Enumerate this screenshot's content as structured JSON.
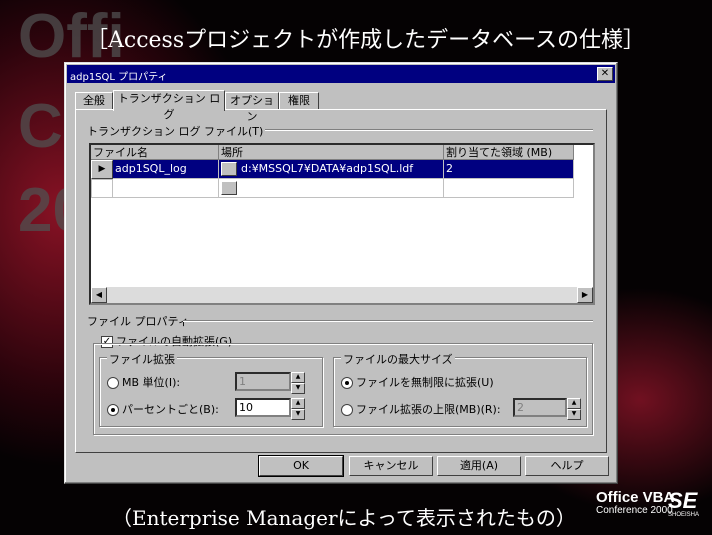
{
  "slide": {
    "title": "［Accessプロジェクトが作成したデータベースの仕様］",
    "caption": "（Enterprise Managerによって表示されたもの）",
    "bg_letters": [
      "Offi",
      "C",
      "20"
    ],
    "logo_line1": "Office VBA",
    "logo_line2": "Conference 2000",
    "logo_mark": "SE",
    "logo_sub": "SHOEISHA"
  },
  "dialog": {
    "title": "adp1SQL プロパティ",
    "close": "✕",
    "tabs": [
      "全般",
      "トランザクション ログ",
      "オプション",
      "権限"
    ],
    "active_tab": 1,
    "log_files_label": "トランザクション ログ ファイル(T)",
    "columns": [
      "ファイル名",
      "場所",
      "割り当てた領域 (MB)"
    ],
    "rows": [
      {
        "name": "adp1SQL_log",
        "location": "d:¥MSSQL7¥DATA¥adp1SQL.ldf",
        "size": "2",
        "selected": true
      },
      {
        "name": "",
        "location": "",
        "size": "",
        "selected": false
      }
    ],
    "file_props_label": "ファイル プロパティ",
    "auto_grow_label": "ファイルの自動拡張(G)",
    "auto_grow_checked": true,
    "growth_group": "ファイル拡張",
    "mb_option": "MB 単位(I):",
    "mb_value": "1",
    "percent_option": "パーセントごと(B):",
    "percent_value": "10",
    "maxsize_group": "ファイルの最大サイズ",
    "unlimited_option": "ファイルを無制限に拡張(U)",
    "limit_option": "ファイル拡張の上限(MB)(R):",
    "limit_value": "2",
    "buttons": {
      "ok": "OK",
      "cancel": "キャンセル",
      "apply": "適用(A)",
      "help": "ヘルプ"
    }
  }
}
